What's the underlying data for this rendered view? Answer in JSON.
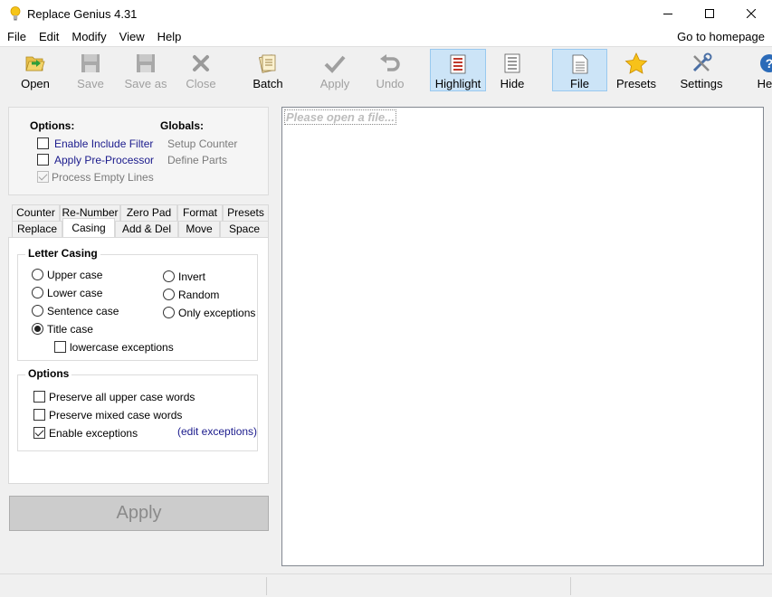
{
  "window": {
    "title": "Replace Genius 4.31"
  },
  "menu": {
    "items": [
      "File",
      "Edit",
      "Modify",
      "View",
      "Help"
    ],
    "homepage": "Go to homepage"
  },
  "toolbar": {
    "open": "Open",
    "save": "Save",
    "save_as": "Save as",
    "close": "Close",
    "batch": "Batch",
    "apply": "Apply",
    "undo": "Undo",
    "highlight": "Highlight",
    "hide": "Hide",
    "file": "File",
    "presets": "Presets",
    "settings": "Settings",
    "help": "Help"
  },
  "options": {
    "heading": "Options:",
    "include_filter": "Enable Include Filter",
    "pre_processor": "Apply Pre-Processor",
    "empty_lines": "Process Empty Lines"
  },
  "globals": {
    "heading": "Globals:",
    "setup_counter": "Setup Counter",
    "define_parts": "Define Parts"
  },
  "tabs": {
    "row1": [
      "Counter",
      "Re-Number",
      "Zero Pad",
      "Format",
      "Presets"
    ],
    "row2": [
      "Replace",
      "Casing",
      "Add & Del",
      "Move",
      "Space"
    ],
    "active": "Casing"
  },
  "letter_casing": {
    "title": "Letter Casing",
    "upper": "Upper case",
    "lower": "Lower case",
    "sentence": "Sentence case",
    "title_case": "Title case",
    "invert": "Invert",
    "random": "Random",
    "only_exceptions": "Only exceptions",
    "lowercase_exceptions": "lowercase exceptions",
    "selected": "Title case"
  },
  "casing_options": {
    "title": "Options",
    "preserve_upper": "Preserve all upper case words",
    "preserve_mixed": "Preserve mixed case words",
    "enable_exceptions": "Enable exceptions",
    "edit_exceptions": "(edit exceptions)"
  },
  "apply_button": "Apply",
  "editor": {
    "placeholder": "Please open a file..."
  },
  "colors": {
    "active_tool_bg": "#cce4f7",
    "active_tool_border": "#99c9ef",
    "link": "#1a1a8c"
  }
}
